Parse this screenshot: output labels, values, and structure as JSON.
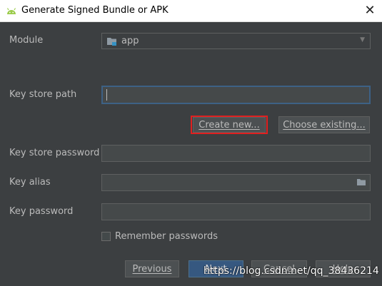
{
  "window": {
    "title": "Generate Signed Bundle or APK",
    "close_glyph": "✕"
  },
  "module": {
    "label": "Module",
    "value": "app"
  },
  "key_store_path": {
    "label": "Key store path",
    "value": ""
  },
  "buttons": {
    "create_new": "Create new...",
    "choose_existing": "Choose existing...",
    "previous": "Previous",
    "next": "Next",
    "cancel": "Cancel",
    "help": "Help"
  },
  "key_store_password": {
    "label": "Key store password",
    "value": ""
  },
  "key_alias": {
    "label": "Key alias",
    "value": ""
  },
  "key_password": {
    "label": "Key password",
    "value": ""
  },
  "remember": {
    "label": "Remember passwords",
    "checked": false
  },
  "watermark": "https://blog.csdn.net/qq_38436214",
  "colors": {
    "background": "#3c3f41",
    "highlight": "#e02020",
    "focus": "#3d6185",
    "android_green": "#9ccc4c"
  }
}
